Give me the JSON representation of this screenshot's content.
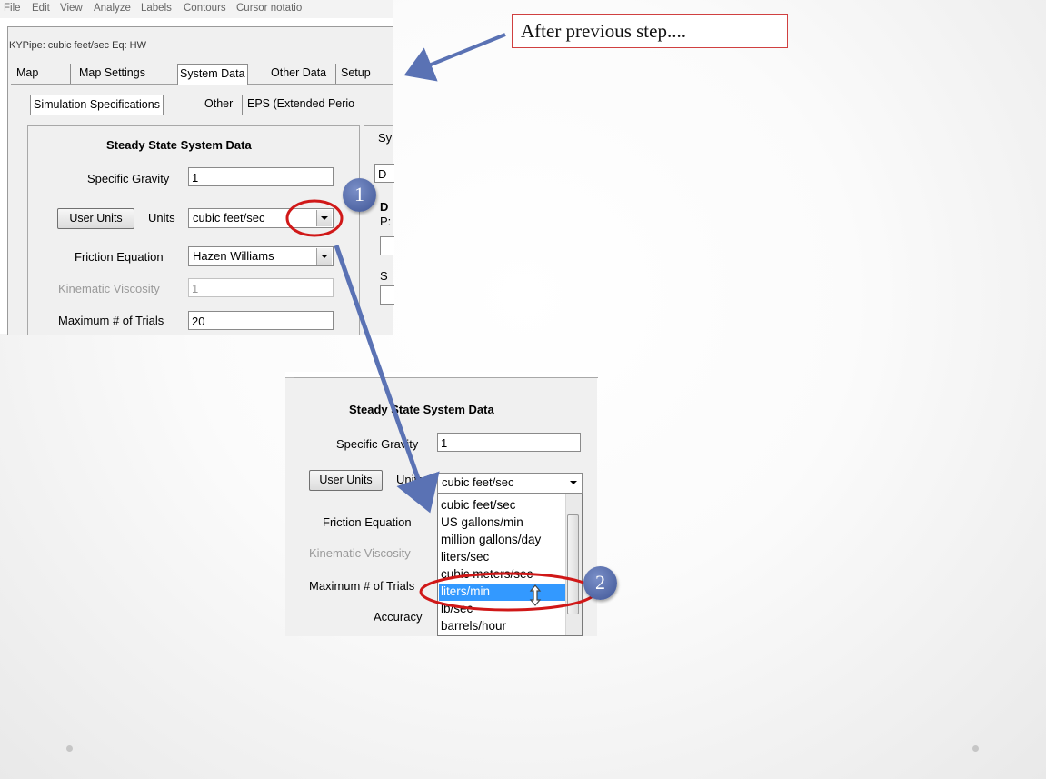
{
  "menu": [
    "File",
    "Edit",
    "View",
    "Analyze",
    "Labels",
    "Contours",
    "Cursor notatio"
  ],
  "window_title": "KYPipe: cubic feet/sec  Eq: HW",
  "main_tabs": [
    "Map",
    "Map Settings",
    "System Data",
    "Other Data",
    "Setup"
  ],
  "sub_tabs": [
    "Simulation Specifications",
    "Other",
    "EPS  (Extended Perio"
  ],
  "callout": "After previous step....",
  "panel": {
    "heading": "Steady State System Data",
    "specific_gravity_label": "Specific Gravity",
    "specific_gravity_value": "1",
    "user_units_button": "User Units",
    "units_label": "Units",
    "units_value": "cubic feet/sec",
    "friction_label": "Friction Equation",
    "friction_value": "Hazen Williams",
    "kinematic_label": "Kinematic Viscosity",
    "kinematic_value": "1",
    "max_trials_label": "Maximum # of Trials",
    "max_trials_value": "20"
  },
  "right_panel_fragments": [
    "Sy",
    "D",
    "D",
    "P:",
    "S"
  ],
  "zoom_panel": {
    "heading": "Steady State System Data",
    "specific_gravity_label": "Specific Gravity",
    "specific_gravity_value": "1",
    "user_units_button": "User Units",
    "units_label": "Units",
    "units_value": "cubic feet/sec",
    "friction_label": "Friction Equation",
    "kinematic_label": "Kinematic Viscosity",
    "max_trials_label": "Maximum # of Trials",
    "accuracy_label": "Accuracy"
  },
  "unit_options": [
    "cubic feet/sec",
    "US gallons/min",
    "million gallons/day",
    "liters/sec",
    "cubic meters/sec",
    "liters/min",
    "lb/sec",
    "barrels/hour"
  ],
  "selected_option": "liters/min",
  "badges": [
    "1",
    "2"
  ],
  "colors": {
    "arrow": "#5a72b4",
    "highlight": "#d01818",
    "selection": "#3399ff",
    "badge": "#4a5f9e"
  }
}
